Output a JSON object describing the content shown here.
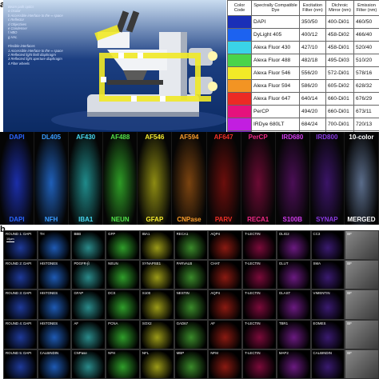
{
  "panels": {
    "top_letter": "a",
    "bottom_letter": "b"
  },
  "microscope": {
    "legend_lines": [
      "Beam path optics",
      "a  Ocular",
      "b  Accessible interface to the ∞ space",
      "c  Reflector",
      "d  Objectives",
      "e  Condenser",
      "f  HBO",
      "g  HAL",
      "",
      "Flexible interfaces",
      "1  Accessible interface to the ∞ space",
      "2  Reflected light field diaphragm",
      "3  Reflected light aperture diaphragm",
      "4  Filter wheels"
    ]
  },
  "dye_table": {
    "headers": [
      "Color Code",
      "Spectrally Compatible Dye",
      "Excitation Filter (nm)",
      "Dichroic Mirror (nm)",
      "Emission Filter (nm)"
    ],
    "rows": [
      {
        "color": "#1a2fb8",
        "dye": "DAPI",
        "ex": "350/50",
        "di": "400-Di01",
        "em": "460/50"
      },
      {
        "color": "#1c62f0",
        "dye": "DyLight 405",
        "ex": "400/12",
        "di": "458-Di02",
        "em": "466/40"
      },
      {
        "color": "#3ad3e8",
        "dye": "Alexa Fluor 430",
        "ex": "427/10",
        "di": "458-Di01",
        "em": "520/40"
      },
      {
        "color": "#49d44a",
        "dye": "Alexa Fluor 488",
        "ex": "482/18",
        "di": "495-Di03",
        "em": "510/20"
      },
      {
        "color": "#f2ea27",
        "dye": "Alexa Fluor 546",
        "ex": "556/20",
        "di": "572-Di01",
        "em": "578/16"
      },
      {
        "color": "#f39423",
        "dye": "Alexa Fluor 594",
        "ex": "586/20",
        "di": "605-Di02",
        "em": "628/32"
      },
      {
        "color": "#ec2a24",
        "dye": "Alexa Fluor 647",
        "ex": "640/14",
        "di": "660-Di01",
        "em": "676/29"
      },
      {
        "color": "#e5127d",
        "dye": "PerCP",
        "ex": "494/20",
        "di": "660-Di01",
        "em": "673/11"
      },
      {
        "color": "#c21ee0",
        "dye": "IRDye 680LT",
        "ex": "684/24",
        "di": "700-Di01",
        "em": "720/13"
      },
      {
        "color": "#7a1ec9",
        "dye": "IRDye 800CW",
        "ex": "747/33",
        "di": "776-Di01",
        "em": "776/LP"
      }
    ]
  },
  "strip": {
    "tiles": [
      {
        "top": "DAPI",
        "top_color": "#2a66ff",
        "bottom": "DAPI",
        "bottom_color": "#2a66ff",
        "hue": "#1b2ea8"
      },
      {
        "top": "DL405",
        "top_color": "#3a9cff",
        "bottom": "NFH",
        "bottom_color": "#3a9cff",
        "hue": "#1f5fb8"
      },
      {
        "top": "AF430",
        "top_color": "#48d6ee",
        "bottom": "IBA1",
        "bottom_color": "#48d6ee",
        "hue": "#1f8a8a"
      },
      {
        "top": "AF488",
        "top_color": "#52e04a",
        "bottom": "NEUN",
        "bottom_color": "#52e04a",
        "hue": "#2d9a25"
      },
      {
        "top": "AF546",
        "top_color": "#f4ea30",
        "bottom": "GFAP",
        "bottom_color": "#f4ea30",
        "hue": "#8c8a12"
      },
      {
        "top": "AF594",
        "top_color": "#f59a2c",
        "bottom": "CNPase",
        "bottom_color": "#f59a2c",
        "hue": "#7a4310"
      },
      {
        "top": "AF647",
        "top_color": "#f03028",
        "bottom": "PARV",
        "bottom_color": "#f03028",
        "hue": "#6a0e0c"
      },
      {
        "top": "PerCP",
        "top_color": "#ee2a86",
        "bottom": "RECA1",
        "bottom_color": "#ee2a86",
        "hue": "#6a0a33"
      },
      {
        "top": "IRD680",
        "top_color": "#cf3cea",
        "bottom": "S100B",
        "bottom_color": "#cf3cea",
        "hue": "#4a0e55"
      },
      {
        "top": "IRD800",
        "top_color": "#8a3ae0",
        "bottom": "SYNAP",
        "bottom_color": "#8a3ae0",
        "hue": "#3a1466"
      },
      {
        "top": "10-color",
        "top_color": "#ffffff",
        "bottom": "MERGED",
        "bottom_color": "#ffffff",
        "hue": "#5a6c8a"
      }
    ]
  },
  "grid": {
    "scale_label": "10μm",
    "columns_hue": [
      "#1e3a9a",
      "#1e5ab4",
      "#2a8a8a",
      "#2f9d2a",
      "#9a9a18",
      "#3a8a2a",
      "#8a1a12",
      "#7a0a3a",
      "#6a1a80",
      "#3a1a70",
      "#777777"
    ],
    "rows": [
      [
        "ROUND 1: DAPI",
        "TH",
        "BBB",
        "GFP",
        "IBA1",
        "RECA1",
        "AQP4",
        "T-LECTIN",
        "OLIG2",
        "CC3",
        "BF"
      ],
      [
        "ROUND 2: DAPI",
        "HISTONES",
        "PDGFR-β",
        "NEUN",
        "SYNAPSE1",
        "PARVALB",
        "CHAT",
        "T-LECTIN",
        "GLUT",
        "SMA",
        "BF"
      ],
      [
        "ROUND 3: DAPI",
        "HISTONES",
        "GFAP",
        "DCX",
        "S100",
        "NESTIN",
        "AQP4",
        "T-LECTIN",
        "GLAST",
        "VIMENTIN",
        "BF"
      ],
      [
        "ROUND 4: DAPI",
        "HISTONES",
        "AF",
        "PCNA",
        "SOX2",
        "GAD67",
        "AF",
        "T-LECTIN",
        "TBR1",
        "EOMES",
        "BF"
      ],
      [
        "ROUND 5: DAPI",
        "CALBINDIN",
        "CNPase",
        "NFH",
        "NFL",
        "MBP",
        "NFM",
        "T-LECTIN",
        "MAP2",
        "CALBINDIN",
        "BF"
      ]
    ]
  }
}
